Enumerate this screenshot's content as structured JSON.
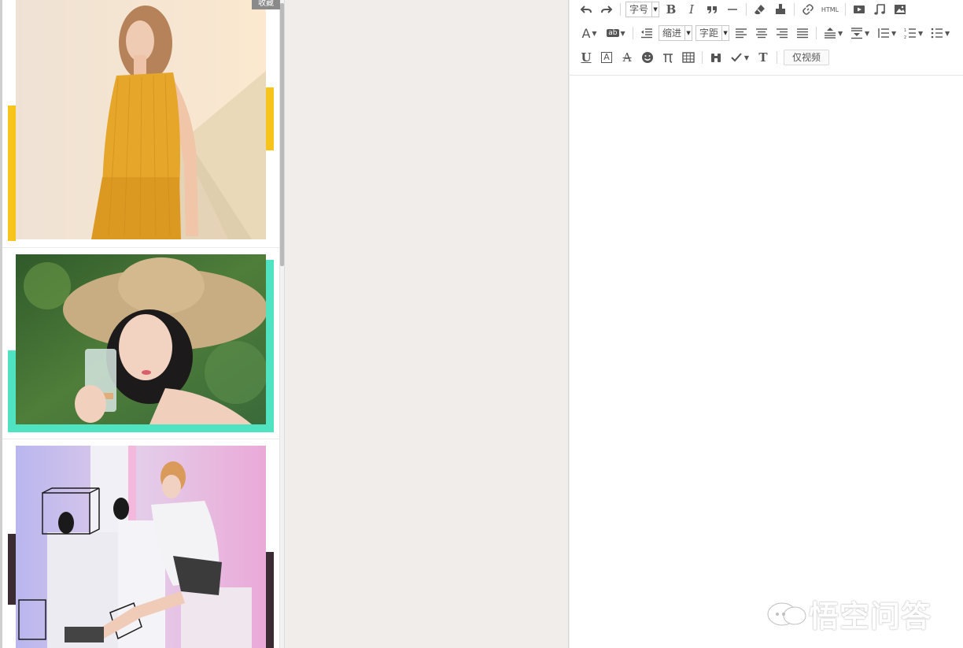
{
  "left_panel": {
    "collect_label": "收藏",
    "cards": [
      {
        "accent_color": "#f7c41b",
        "theme": "woman in mustard pleated top"
      },
      {
        "accent_color": "#4fe3c1",
        "theme": "woman in straw hat with glass"
      },
      {
        "accent_color": "#3b2b33",
        "theme": "woman posing with shoes and cubes"
      }
    ]
  },
  "toolbar": {
    "row1": {
      "undo": "undo-icon",
      "redo": "redo-icon",
      "font_size_label": "字号",
      "bold": "B",
      "italic": "I",
      "quote": "quote-icon",
      "hr": "horizontal-rule-icon",
      "eraser": "eraser-icon",
      "format_painter": "format-painter-icon",
      "link": "link-icon",
      "html_label": "HTML",
      "video": "video-icon",
      "music": "music-icon",
      "image": "image-icon"
    },
    "row2": {
      "font_color": "A",
      "highlight": "ab",
      "indent_label": "缩进",
      "spacing_label": "字距"
    },
    "row3": {
      "underline": "U",
      "boxed_a": "A",
      "strike": "A",
      "text_t": "T",
      "video_only_label": "仅视频"
    }
  },
  "watermark": {
    "text": "悟空问答"
  },
  "colors": {
    "editor_bg": "#ffffff",
    "middle_bg": "#f0edea",
    "icon": "#555555"
  }
}
